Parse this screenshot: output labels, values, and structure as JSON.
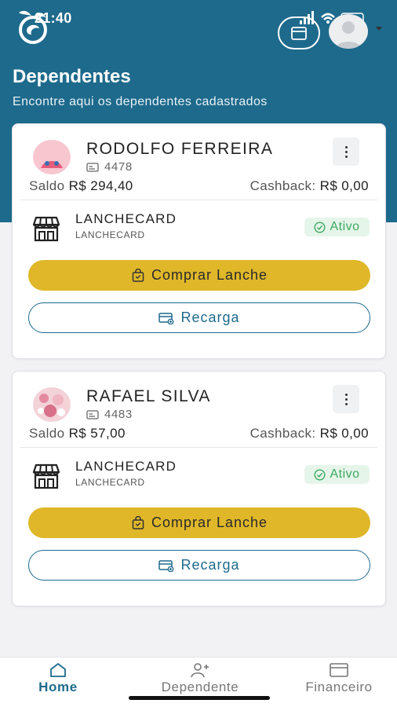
{
  "status_bar": {
    "time": "21:40"
  },
  "header": {
    "title": "Dependentes",
    "subtitle": "Encontre aqui os dependentes cadastrados"
  },
  "dependents": [
    {
      "name": "RODOLFO FERREIRA",
      "id": "4478",
      "saldo_label": "Saldo",
      "saldo_value": "R$ 294,40",
      "cashback_label": "Cashback:",
      "cashback_value": "R$ 0,00",
      "product_name": "LANCHECARD",
      "product_sub": "LANCHECARD",
      "status": "Ativo",
      "buy_label": "Comprar Lanche",
      "recharge_label": "Recarga"
    },
    {
      "name": "RAFAEL SILVA",
      "id": "4483",
      "saldo_label": "Saldo",
      "saldo_value": "R$ 57,00",
      "cashback_label": "Cashback:",
      "cashback_value": "R$ 0,00",
      "product_name": "LANCHECARD",
      "product_sub": "LANCHECARD",
      "status": "Ativo",
      "buy_label": "Comprar Lanche",
      "recharge_label": "Recarga"
    }
  ],
  "nav": {
    "items": [
      {
        "label": "Home",
        "icon": "home-icon",
        "active": true
      },
      {
        "label": "Dependente",
        "icon": "add-user-icon",
        "active": false
      },
      {
        "label": "Financeiro",
        "icon": "wallet-icon",
        "active": false
      }
    ]
  },
  "colors": {
    "primary": "#1e6a8c",
    "accent": "#dfb729",
    "status_active": "#3fa860",
    "status_active_bg": "#e5f5ea"
  }
}
